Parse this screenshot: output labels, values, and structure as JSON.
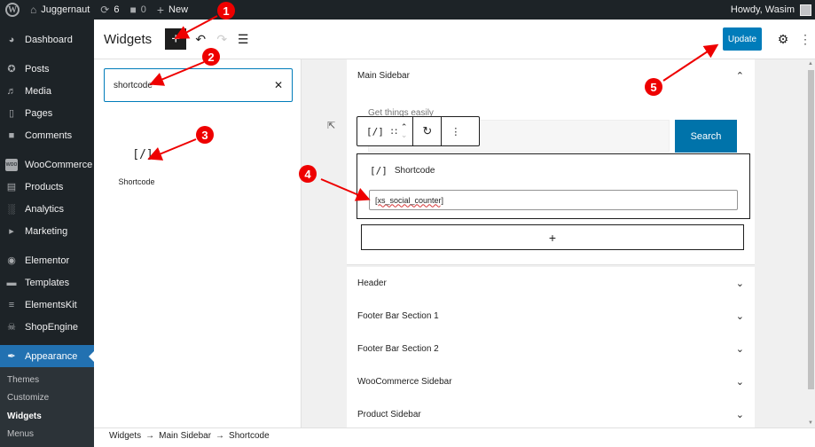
{
  "adminbar": {
    "site_name": "Juggernaut",
    "updates_count": "6",
    "comments_count": "0",
    "new_label": "New",
    "greeting": "Howdy, Wasim"
  },
  "sidebar": {
    "items": [
      {
        "label": "Dashboard",
        "icon": "dashboard-icon"
      },
      {
        "label": "Posts",
        "icon": "pin-icon"
      },
      {
        "label": "Media",
        "icon": "media-icon"
      },
      {
        "label": "Pages",
        "icon": "pages-icon"
      },
      {
        "label": "Comments",
        "icon": "comment-icon"
      },
      {
        "label": "WooCommerce",
        "icon": "woo-icon"
      },
      {
        "label": "Products",
        "icon": "archive-icon"
      },
      {
        "label": "Analytics",
        "icon": "bar-chart-icon"
      },
      {
        "label": "Marketing",
        "icon": "megaphone-icon"
      },
      {
        "label": "Elementor",
        "icon": "elementor-icon"
      },
      {
        "label": "Templates",
        "icon": "folder-icon"
      },
      {
        "label": "ElementsKit",
        "icon": "elementskit-icon"
      },
      {
        "label": "ShopEngine",
        "icon": "basket-icon"
      },
      {
        "label": "Appearance",
        "icon": "brush-icon",
        "active": true
      }
    ],
    "submenu": [
      {
        "label": "Themes"
      },
      {
        "label": "Customize"
      },
      {
        "label": "Widgets",
        "current": true
      },
      {
        "label": "Menus"
      }
    ]
  },
  "header": {
    "title": "Widgets",
    "inserter_label": "+",
    "update_label": "Update"
  },
  "inserter": {
    "search_value": "shortcode",
    "results": [
      {
        "label": "Shortcode",
        "icon": "[/]"
      }
    ]
  },
  "canvas": {
    "main_area": {
      "title": "Main Sidebar",
      "search_block_label": "Get things easily",
      "search_button_label": "Search",
      "shortcode_block": {
        "icon": "[/]",
        "title": "Shortcode",
        "value": "[xs_social_counter]"
      },
      "toolbar_icon": "[/]"
    },
    "areas": [
      {
        "title": "Header"
      },
      {
        "title": "Footer Bar Section 1"
      },
      {
        "title": "Footer Bar Section 2"
      },
      {
        "title": "WooCommerce Sidebar"
      },
      {
        "title": "Product Sidebar"
      }
    ]
  },
  "breadcrumb": [
    "Widgets",
    "Main Sidebar",
    "Shortcode"
  ],
  "annotations": [
    "1",
    "2",
    "3",
    "4",
    "5"
  ],
  "colors": {
    "admin_dark": "#1d2327",
    "accent": "#007cba",
    "active_menu": "#2271b1",
    "annotation_red": "#e00000"
  }
}
